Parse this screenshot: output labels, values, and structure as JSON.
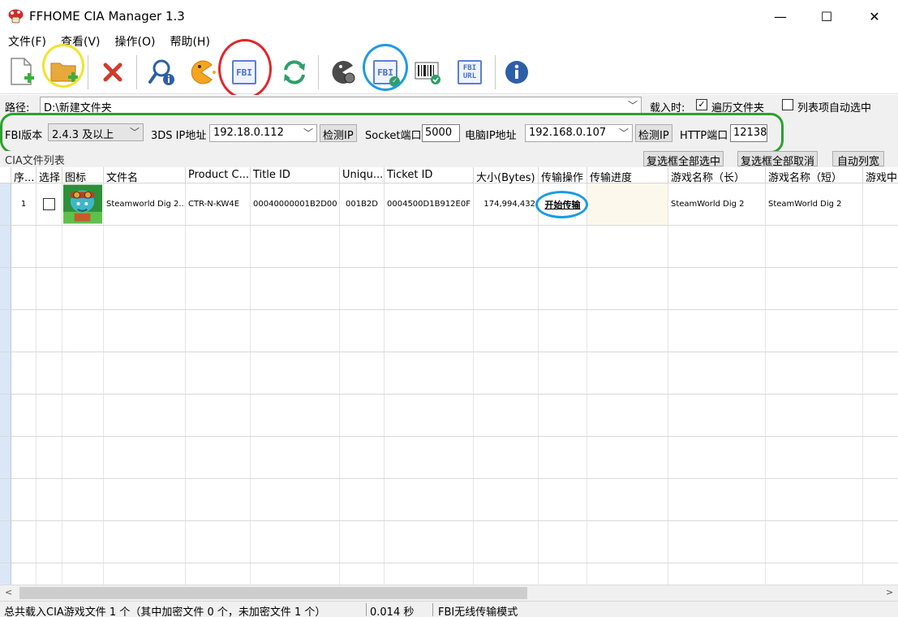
{
  "window": {
    "title": "FFHOME CIA Manager 1.3",
    "minimize": "—",
    "maximize": "☐",
    "close": "✕"
  },
  "menu": [
    "文件(F)",
    "查看(V)",
    "操作(O)",
    "帮助(H)"
  ],
  "toolbar": {
    "fbi_label": "FBI",
    "fbi_check_label": "FBI",
    "fbi_url_line1": "FBI",
    "fbi_url_line2": "URL"
  },
  "path": {
    "label": "路径:",
    "value": "D:\\新建文件夹",
    "load_label": "载入时:",
    "recurse_label": "遍历文件夹",
    "recurse_checked": true,
    "autoselect_label": "列表项自动选中",
    "autoselect_checked": false
  },
  "settings": {
    "fbi_version_label": "FBI版本",
    "fbi_version_value": "2.4.3 及以上",
    "ds_ip_label": "3DS IP地址",
    "ds_ip_value": "192.18.0.112",
    "detect_ip_label": "检测IP",
    "socket_port_label": "Socket端口",
    "socket_port_value": "5000",
    "pc_ip_label": "电脑IP地址",
    "pc_ip_value": "192.168.0.107",
    "detect_ip2_label": "检测IP",
    "http_port_label": "HTTP端口",
    "http_port_value": "12138"
  },
  "list": {
    "title": "CIA文件列表",
    "select_all": "复选框全部选中",
    "deselect_all": "复选框全部取消",
    "auto_width": "自动列宽",
    "columns": [
      "序...",
      "选择",
      "图标",
      "文件名",
      "Product C...",
      "Title ID",
      "Uniqu...",
      "Ticket ID",
      "大小(Bytes)",
      "传输操作",
      "传输进度",
      "游戏名称（长）",
      "游戏名称（短）",
      "游戏中"
    ],
    "rows": [
      {
        "index": "1",
        "checked": false,
        "file_name": "Steamworld Dig 2...",
        "product_code": "CTR-N-KW4E",
        "title_id": "00040000001B2D00",
        "unique_id": "001B2D",
        "ticket_id": "0004500D1B912E0F",
        "size": "174,994,432",
        "action": "开始传输",
        "progress": "",
        "name_long": "SteamWorld Dig 2",
        "name_short": "SteamWorld Dig 2"
      }
    ]
  },
  "status": {
    "summary": "总共载入CIA游戏文件 1 个（其中加密文件 0 个，未加密文件 1 个）",
    "time": "0.014 秒",
    "mode": "FBI无线传输模式"
  },
  "colors": {
    "ring_yellow": "#f2e32a",
    "ring_red": "#e0262b",
    "ring_blue": "#1e9be0",
    "ring_green": "#2ca02c"
  }
}
